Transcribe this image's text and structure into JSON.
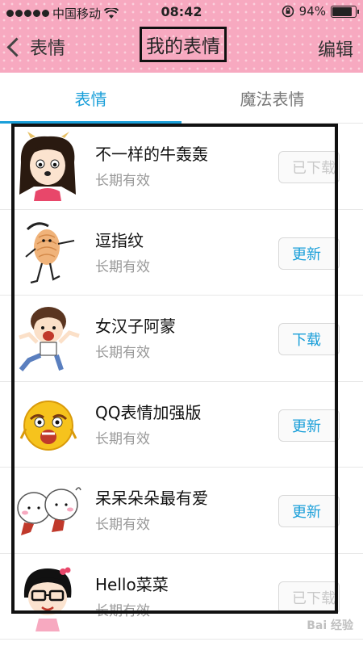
{
  "status": {
    "carrier": "中国移动",
    "time": "08:42",
    "battery": "94%",
    "battery_level": 0.94
  },
  "nav": {
    "back_label": "表情",
    "title": "我的表情",
    "edit_label": "编辑"
  },
  "tabs": [
    {
      "label": "表情",
      "active": true
    },
    {
      "label": "魔法表情",
      "active": false
    }
  ],
  "items": [
    {
      "name": "不一样的牛轰轰",
      "validity": "长期有效",
      "action": "已下载",
      "state": "downloaded",
      "icon": "bull-girl-icon"
    },
    {
      "name": "逗指纹",
      "validity": "长期有效",
      "action": "更新",
      "state": "update",
      "icon": "fingerprint-man-icon"
    },
    {
      "name": "女汉子阿蒙",
      "validity": "长期有效",
      "action": "下载",
      "state": "download",
      "icon": "amon-girl-icon"
    },
    {
      "name": "QQ表情加强版",
      "validity": "长期有效",
      "action": "更新",
      "state": "update",
      "icon": "qq-face-icon"
    },
    {
      "name": "呆呆朵朵最有爱",
      "validity": "长期有效",
      "action": "更新",
      "state": "update",
      "icon": "twin-babies-icon"
    },
    {
      "name": "Hello菜菜",
      "validity": "长期有效",
      "action": "已下载",
      "state": "downloaded",
      "icon": "caicai-girl-icon"
    }
  ],
  "watermark": "Bai 经验",
  "colors": {
    "accent": "#1a9fd9",
    "header": "#f7a9c0"
  }
}
